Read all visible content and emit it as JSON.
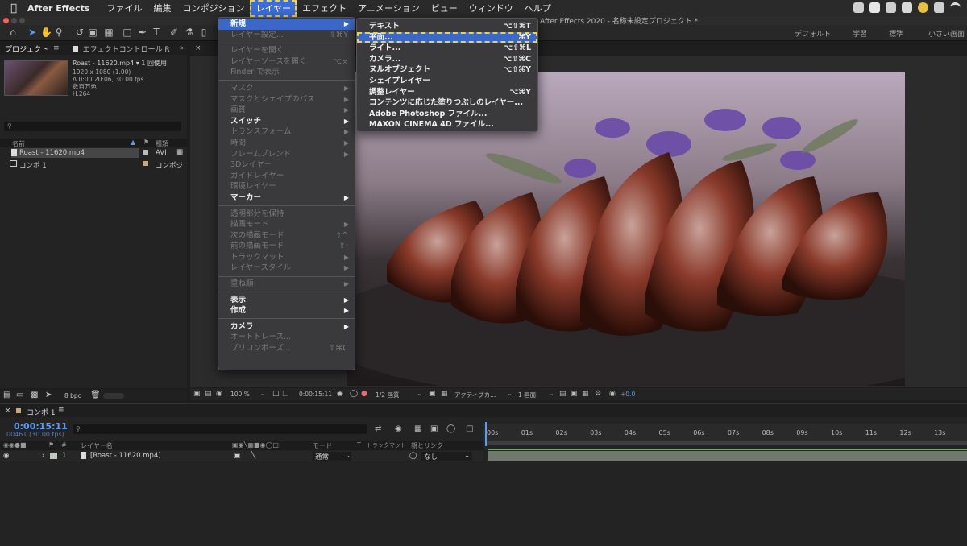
{
  "menubar": {
    "app_name": "After Effects",
    "items": [
      "ファイル",
      "編集",
      "コンポジション",
      "レイヤー",
      "エフェクト",
      "アニメーション",
      "ビュー",
      "ウィンドウ",
      "ヘルプ"
    ],
    "active_item": "レイヤー"
  },
  "window": {
    "title": "After Effects 2020 - 名称未設定プロジェクト *"
  },
  "workspaces": [
    "デフォルト",
    "学習",
    "標準",
    "小さい画面"
  ],
  "project_panel": {
    "tab_project": "プロジェクト",
    "tab_effects": "エフェクトコントロール R",
    "selected_file": "Roast - 11620.mp4 ▾ 1 回使用",
    "info_lines": [
      "1920 x 1080 (1.00)",
      "Δ 0:00:20:06, 30.00 fps",
      "数百万色",
      "H.264"
    ],
    "col_name": "名前",
    "col_type": "種類",
    "files": [
      {
        "name": "Roast - 11620.mp4",
        "type": "AVI"
      },
      {
        "name": "コンポ 1",
        "type": "コンポジ"
      }
    ],
    "bpc": "8 bpc"
  },
  "viewer_bar": {
    "zoom": "100 %",
    "timecode": "0:00:15:11",
    "resolution": "1/2 画質",
    "camera": "アクティブカ...",
    "views": "1 画面",
    "exposure": "+0.0"
  },
  "layer_menu": {
    "items": [
      {
        "label": "新規",
        "arrow": true,
        "state": "highlight"
      },
      {
        "label": "レイヤー設定...",
        "shortcut": "⇧⌘Y",
        "state": "disabled"
      },
      {
        "sep": true
      },
      {
        "label": "レイヤーを開く",
        "state": "disabled"
      },
      {
        "label": "レイヤーソースを開く",
        "shortcut": "⌥⌅",
        "state": "disabled"
      },
      {
        "label": "Finder で表示",
        "state": "disabled"
      },
      {
        "sep": true
      },
      {
        "label": "マスク",
        "arrow": true,
        "state": "disabled"
      },
      {
        "label": "マスクとシェイプのパス",
        "arrow": true,
        "state": "disabled"
      },
      {
        "label": "画質",
        "arrow": true,
        "state": "disabled"
      },
      {
        "label": "スイッチ",
        "arrow": true,
        "state": "bold"
      },
      {
        "label": "トランスフォーム",
        "arrow": true,
        "state": "disabled"
      },
      {
        "label": "時間",
        "arrow": true,
        "state": "disabled"
      },
      {
        "label": "フレームブレンド",
        "arrow": true,
        "state": "disabled"
      },
      {
        "label": "3Dレイヤー",
        "state": "disabled"
      },
      {
        "label": "ガイドレイヤー",
        "state": "disabled"
      },
      {
        "label": "環境レイヤー",
        "state": "disabled"
      },
      {
        "label": "マーカー",
        "arrow": true,
        "state": "bold"
      },
      {
        "sep": true
      },
      {
        "label": "透明部分を保持",
        "state": "disabled"
      },
      {
        "label": "描画モード",
        "arrow": true,
        "state": "disabled"
      },
      {
        "label": "次の描画モード",
        "shortcut": "⇧^",
        "state": "disabled"
      },
      {
        "label": "前の描画モード",
        "shortcut": "⇧-",
        "state": "disabled"
      },
      {
        "label": "トラックマット",
        "arrow": true,
        "state": "disabled"
      },
      {
        "label": "レイヤースタイル",
        "arrow": true,
        "state": "disabled"
      },
      {
        "sep": true
      },
      {
        "label": "重ね順",
        "arrow": true,
        "state": "disabled"
      },
      {
        "sep": true
      },
      {
        "label": "表示",
        "arrow": true,
        "state": "bold"
      },
      {
        "label": "作成",
        "arrow": true,
        "state": "bold"
      },
      {
        "sep": true
      },
      {
        "label": "カメラ",
        "arrow": true,
        "state": "bold"
      },
      {
        "label": "オートトレース...",
        "state": "disabled"
      },
      {
        "label": "プリコンポーズ...",
        "shortcut": "⇧⌘C",
        "state": "disabled"
      }
    ]
  },
  "new_submenu": {
    "items": [
      {
        "label": "テキスト",
        "shortcut": "⌥⇧⌘T",
        "state": "normal"
      },
      {
        "label": "平面...",
        "shortcut": "⌘Y",
        "state": "selected"
      },
      {
        "label": "ライト...",
        "shortcut": "⌥⇧⌘L",
        "state": "normal"
      },
      {
        "label": "カメラ...",
        "shortcut": "⌥⇧⌘C",
        "state": "normal"
      },
      {
        "label": "ヌルオブジェクト",
        "shortcut": "⌥⇧⌘Y",
        "state": "normal"
      },
      {
        "label": "シェイプレイヤー",
        "shortcut": "",
        "state": "normal"
      },
      {
        "label": "調整レイヤー",
        "shortcut": "⌥⌘Y",
        "state": "normal"
      },
      {
        "label": "コンテンツに応じた塗りつぶしのレイヤー...",
        "shortcut": "",
        "state": "normal"
      },
      {
        "label": "Adobe Photoshop ファイル...",
        "shortcut": "",
        "state": "normal"
      },
      {
        "label": "MAXON CINEMA 4D ファイル...",
        "shortcut": "",
        "state": "normal"
      }
    ]
  },
  "timeline": {
    "tab": "コンポ 1",
    "timecode": "0:00:15:11",
    "frames": "00461 (30.00 fps)",
    "col_layer_name": "レイヤー名",
    "col_mode": "モード",
    "col_t": "T",
    "col_trkmat": "トラックマット",
    "col_parent": "親とリンク",
    "layer": {
      "index": "1",
      "name": "[Roast - 11620.mp4]",
      "mode": "通常",
      "parent": "なし"
    },
    "ruler": [
      "00s",
      "01s",
      "02s",
      "03s",
      "04s",
      "05s",
      "06s",
      "07s",
      "08s",
      "09s",
      "10s",
      "11s",
      "12s",
      "13s"
    ]
  },
  "comp_tab_label": "コン"
}
